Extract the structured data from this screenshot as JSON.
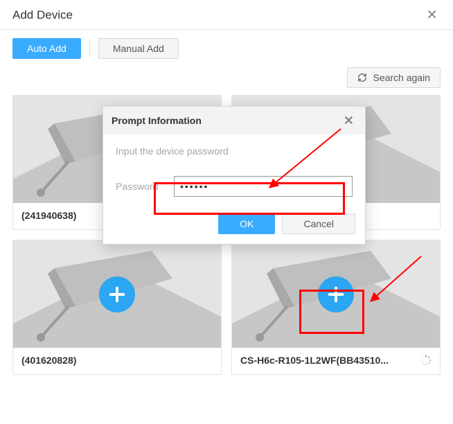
{
  "header": {
    "title": "Add Device"
  },
  "toolbar": {
    "auto_add": "Auto Add",
    "manual_add": "Manual Add",
    "search_again": "Search again"
  },
  "modal": {
    "title": "Prompt Information",
    "instruction": "Input the device password",
    "password_label": "Password",
    "password_value": "••••••",
    "ok": "OK",
    "cancel": "Cancel"
  },
  "devices": [
    {
      "name": "(241940638)"
    },
    {
      "name": ""
    },
    {
      "name": "(401620828)"
    },
    {
      "name": "CS-H6c-R105-1L2WF(BB43510...",
      "loading": true
    }
  ]
}
